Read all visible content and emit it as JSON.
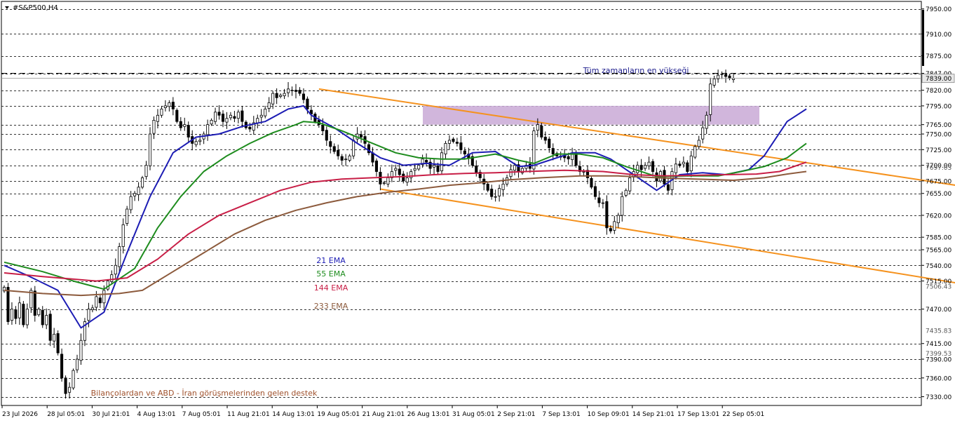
{
  "symbol": "#S&P500,H4",
  "chart_data": {
    "type": "candlestick",
    "instrument": "#S&P500",
    "timeframe": "H4",
    "price_scale": {
      "min": 7316,
      "max": 7962,
      "levels": [
        7950.0,
        7910.0,
        7875.0,
        7847.0,
        7820.0,
        7795.0,
        7765.0,
        7750.0,
        7725.0,
        7700.0,
        7675.0,
        7655.0,
        7620.0,
        7585.0,
        7565.0,
        7540.0,
        7515.0,
        7470.0,
        7415.0,
        7390.0,
        7360.0,
        7330.0
      ],
      "extra_ticks": [
        7697.03,
        7506.43,
        7435.83,
        7399.53
      ],
      "current_price": 7839.0
    },
    "time_labels": [
      "23 Jul 2026",
      "28 Jul 05:01",
      "30 Jul 21:01",
      "4 Aug 13:01",
      "7 Aug 05:01",
      "11 Aug 21:01",
      "14 Aug 13:01",
      "19 Aug 05:01",
      "21 Aug 21:01",
      "26 Aug 13:01",
      "31 Aug 05:01",
      "2 Sep 21:01",
      "7 Sep 13:01",
      "10 Sep 09:01",
      "14 Sep 21:01",
      "17 Sep 13:01",
      "22 Sep 05:01"
    ],
    "candles_close": [
      7505,
      7450,
      7470,
      7455,
      7480,
      7445,
      7470,
      7500,
      7460,
      7470,
      7445,
      7460,
      7420,
      7430,
      7400,
      7360,
      7335,
      7345,
      7372,
      7390,
      7420,
      7450,
      7470,
      7472,
      7490,
      7480,
      7500,
      7515,
      7525,
      7540,
      7570,
      7605,
      7630,
      7650,
      7655,
      7665,
      7680,
      7700,
      7750,
      7772,
      7780,
      7790,
      7795,
      7800,
      7790,
      7770,
      7760,
      7765,
      7745,
      7735,
      7738,
      7740,
      7750,
      7765,
      7772,
      7785,
      7780,
      7770,
      7775,
      7780,
      7775,
      7785,
      7770,
      7760,
      7758,
      7768,
      7775,
      7780,
      7790,
      7800,
      7815,
      7808,
      7812,
      7815,
      7822,
      7820,
      7818,
      7815,
      7805,
      7790,
      7782,
      7770,
      7765,
      7755,
      7740,
      7730,
      7722,
      7715,
      7708,
      7710,
      7715,
      7740,
      7750,
      7745,
      7735,
      7720,
      7705,
      7690,
      7670,
      7672,
      7680,
      7690,
      7695,
      7685,
      7675,
      7680,
      7690,
      7695,
      7700,
      7710,
      7705,
      7695,
      7700,
      7690,
      7720,
      7735,
      7740,
      7738,
      7735,
      7725,
      7718,
      7712,
      7700,
      7688,
      7680,
      7670,
      7660,
      7650,
      7650,
      7663,
      7670,
      7680,
      7693,
      7700,
      7690,
      7695,
      7700,
      7695,
      7755,
      7765,
      7745,
      7740,
      7728,
      7718,
      7715,
      7715,
      7712,
      7710,
      7718,
      7700,
      7690,
      7690,
      7680,
      7665,
      7650,
      7640,
      7640,
      7600,
      7595,
      7610,
      7620,
      7650,
      7660,
      7680,
      7690,
      7700,
      7693,
      7700,
      7705,
      7690,
      7675,
      7690,
      7670,
      7660,
      7690,
      7702,
      7700,
      7705,
      7690,
      7715,
      7730,
      7740,
      7760,
      7780,
      7830,
      7838,
      7844,
      7846,
      7842,
      7839,
      7839
    ],
    "annotations": {
      "all_time_high": "Tüm zamanların en yükseği",
      "support_note": "Bilançolardan ve ABD - İran görüşmelerinden gelen destek"
    },
    "ath_level": 7847.0,
    "resistance_zone": [
      7765,
      7795
    ],
    "indicators": [
      {
        "name": "21 EMA",
        "period": 21,
        "color": "#1c1cb4"
      },
      {
        "name": "55 EMA",
        "period": 55,
        "color": "#1e8c1e"
      },
      {
        "name": "144 EMA",
        "period": 144,
        "color": "#c81e46"
      },
      {
        "name": "233 EMA",
        "period": 233,
        "color": "#8c5a3c"
      }
    ],
    "ema_lines": [
      {
        "name": "21 EMA",
        "points": [
          [
            0,
            7540
          ],
          [
            6,
            7524
          ],
          [
            14,
            7500
          ],
          [
            20,
            7440
          ],
          [
            26,
            7465
          ],
          [
            32,
            7560
          ],
          [
            38,
            7650
          ],
          [
            44,
            7720
          ],
          [
            50,
            7745
          ],
          [
            56,
            7750
          ],
          [
            62,
            7762
          ],
          [
            68,
            7770
          ],
          [
            74,
            7790
          ],
          [
            78,
            7795
          ],
          [
            80,
            7780
          ],
          [
            86,
            7760
          ],
          [
            92,
            7735
          ],
          [
            98,
            7712
          ],
          [
            104,
            7700
          ],
          [
            110,
            7703
          ],
          [
            116,
            7700
          ],
          [
            122,
            7720
          ],
          [
            128,
            7722
          ],
          [
            134,
            7698
          ],
          [
            138,
            7700
          ],
          [
            142,
            7708
          ],
          [
            148,
            7720
          ],
          [
            154,
            7720
          ],
          [
            158,
            7710
          ],
          [
            164,
            7685
          ],
          [
            170,
            7660
          ],
          [
            176,
            7685
          ],
          [
            182,
            7688
          ],
          [
            188,
            7685
          ],
          [
            194,
            7693
          ],
          [
            198,
            7715
          ],
          [
            204,
            7770
          ],
          [
            209,
            7790
          ]
        ]
      },
      {
        "name": "55 EMA",
        "points": [
          [
            0,
            7545
          ],
          [
            10,
            7530
          ],
          [
            18,
            7515
          ],
          [
            26,
            7502
          ],
          [
            34,
            7535
          ],
          [
            40,
            7600
          ],
          [
            46,
            7650
          ],
          [
            52,
            7690
          ],
          [
            58,
            7715
          ],
          [
            64,
            7735
          ],
          [
            70,
            7752
          ],
          [
            76,
            7765
          ],
          [
            78,
            7770
          ],
          [
            82,
            7768
          ],
          [
            88,
            7755
          ],
          [
            96,
            7735
          ],
          [
            102,
            7720
          ],
          [
            108,
            7712
          ],
          [
            114,
            7710
          ],
          [
            120,
            7710
          ],
          [
            128,
            7718
          ],
          [
            134,
            7708
          ],
          [
            138,
            7703
          ],
          [
            144,
            7718
          ],
          [
            150,
            7718
          ],
          [
            156,
            7712
          ],
          [
            162,
            7698
          ],
          [
            170,
            7682
          ],
          [
            178,
            7683
          ],
          [
            186,
            7683
          ],
          [
            192,
            7690
          ],
          [
            198,
            7698
          ],
          [
            204,
            7712
          ],
          [
            209,
            7735
          ]
        ]
      },
      {
        "name": "144 EMA",
        "points": [
          [
            0,
            7528
          ],
          [
            10,
            7522
          ],
          [
            18,
            7518
          ],
          [
            24,
            7515
          ],
          [
            32,
            7520
          ],
          [
            40,
            7550
          ],
          [
            48,
            7590
          ],
          [
            56,
            7620
          ],
          [
            64,
            7640
          ],
          [
            72,
            7660
          ],
          [
            80,
            7673
          ],
          [
            88,
            7678
          ],
          [
            96,
            7680
          ],
          [
            104,
            7682
          ],
          [
            112,
            7685
          ],
          [
            120,
            7687
          ],
          [
            128,
            7688
          ],
          [
            136,
            7690
          ],
          [
            146,
            7692
          ],
          [
            156,
            7690
          ],
          [
            164,
            7685
          ],
          [
            172,
            7683
          ],
          [
            180,
            7684
          ],
          [
            188,
            7685
          ],
          [
            196,
            7686
          ],
          [
            202,
            7690
          ],
          [
            209,
            7705
          ]
        ]
      },
      {
        "name": "233 EMA",
        "points": [
          [
            0,
            7500
          ],
          [
            10,
            7495
          ],
          [
            20,
            7492
          ],
          [
            30,
            7495
          ],
          [
            36,
            7500
          ],
          [
            44,
            7530
          ],
          [
            52,
            7560
          ],
          [
            60,
            7590
          ],
          [
            68,
            7612
          ],
          [
            76,
            7628
          ],
          [
            84,
            7640
          ],
          [
            92,
            7650
          ],
          [
            100,
            7657
          ],
          [
            108,
            7662
          ],
          [
            116,
            7668
          ],
          [
            124,
            7672
          ],
          [
            132,
            7677
          ],
          [
            140,
            7680
          ],
          [
            150,
            7683
          ],
          [
            160,
            7683
          ],
          [
            170,
            7680
          ],
          [
            180,
            7678
          ],
          [
            190,
            7676
          ],
          [
            198,
            7680
          ],
          [
            204,
            7686
          ],
          [
            209,
            7690
          ]
        ]
      }
    ],
    "trendlines": [
      {
        "points": [
          [
            82,
            7822
          ],
          [
            262,
            7655
          ]
        ]
      },
      {
        "points": [
          [
            98,
            7662
          ],
          [
            262,
            7498
          ]
        ]
      }
    ]
  }
}
